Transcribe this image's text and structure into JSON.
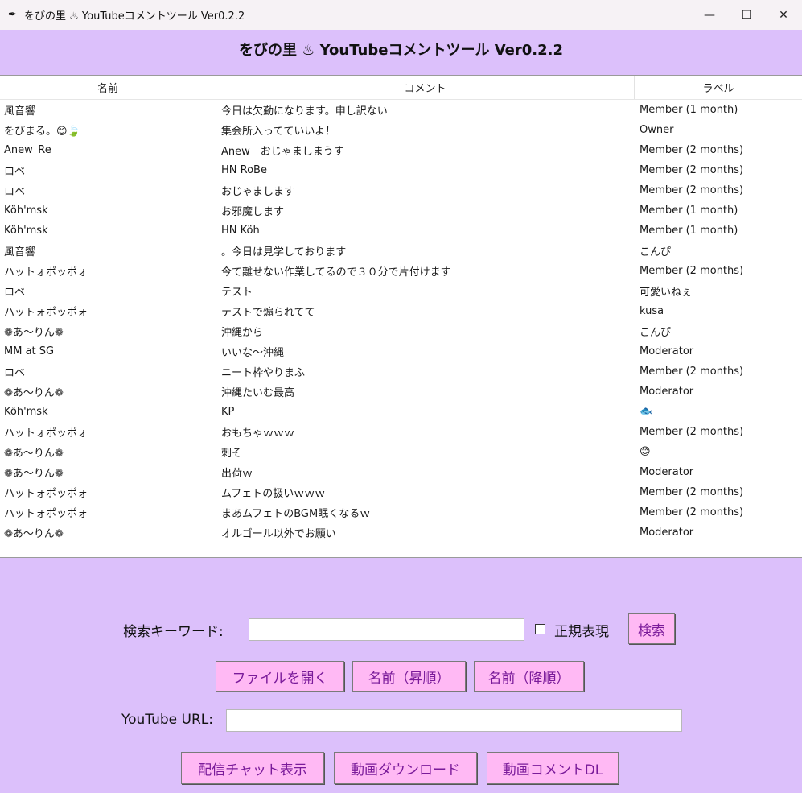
{
  "window": {
    "title": "をびの里 ♨ YouTubeコメントツール Ver0.2.2",
    "minimize": "—",
    "maximize": "☐",
    "close": "✕"
  },
  "header": {
    "title": "をびの里 ♨ YouTubeコメントツール Ver0.2.2"
  },
  "table": {
    "columns": [
      "名前",
      "コメント",
      "ラベル"
    ],
    "rows": [
      [
        "風音響",
        "今日は欠勤になります。申し訳ない",
        "Member (1 month)"
      ],
      [
        "をびまる。😊🍃",
        "集会所入ってていいよ！",
        "Owner"
      ],
      [
        "Anew_Re",
        "Anew　おじゃましまうす",
        "Member (2 months)"
      ],
      [
        "ロベ",
        "HN RoBe",
        "Member (2 months)"
      ],
      [
        "ロベ",
        "おじゃまします",
        "Member (2 months)"
      ],
      [
        "Köh'msk",
        "お邪魔します",
        "Member (1 month)"
      ],
      [
        "Köh'msk",
        "HN Köh",
        "Member (1 month)"
      ],
      [
        "風音響",
        "。今日は見学しております",
        "こんぴ"
      ],
      [
        "ハットォポッポォ",
        "今て離せない作業してるので３０分で片付けます",
        "Member (2 months)"
      ],
      [
        "ロベ",
        "テスト",
        "可愛いねぇ"
      ],
      [
        "ハットォポッポォ",
        "テストで煽られてて",
        "kusa"
      ],
      [
        "❁あ〜りん❁",
        "沖縄から",
        "こんぴ"
      ],
      [
        "MM at SG",
        "いいな〜沖縄",
        "Moderator"
      ],
      [
        "ロベ",
        "ニート枠やりまふ",
        "Member (2 months)"
      ],
      [
        "❁あ〜りん❁",
        "沖縄たいむ最高",
        "Moderator"
      ],
      [
        "Köh'msk",
        "KP",
        "🐟"
      ],
      [
        "ハットォポッポォ",
        "おもちゃｗｗｗ",
        "Member (2 months)"
      ],
      [
        "❁あ〜りん❁",
        "刺そ",
        "😊"
      ],
      [
        "❁あ〜りん❁",
        "出荷ｗ",
        "Moderator"
      ],
      [
        "ハットォポッポォ",
        "ムフェトの扱いｗｗｗ",
        "Member (2 months)"
      ],
      [
        "ハットォポッポォ",
        "まあムフェトのBGM眠くなるｗ",
        "Member (2 months)"
      ],
      [
        "❁あ〜りん❁",
        "オルゴール以外でお願い",
        "Moderator"
      ]
    ]
  },
  "search": {
    "label": "検索キーワード:",
    "value": "",
    "regex_label": "正規表現",
    "regex_checked": false,
    "button": "検索"
  },
  "file_buttons": {
    "open": "ファイルを開く",
    "name_asc": "名前（昇順）",
    "name_desc": "名前（降順）"
  },
  "url": {
    "label": "YouTube URL:",
    "value": ""
  },
  "action_buttons": {
    "live_chat": "配信チャット表示",
    "download": "動画ダウンロード",
    "comment_dl": "動画コメントDL"
  },
  "colors": {
    "background": "#dcc0fb",
    "button": "#ffb9f4",
    "button_text": "#7a1b9a"
  }
}
